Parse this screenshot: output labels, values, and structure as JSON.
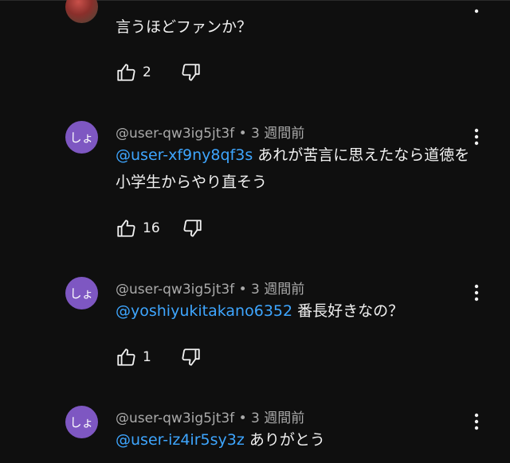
{
  "comments": [
    {
      "avatar_text": "",
      "author": "",
      "time": "",
      "mention": "",
      "text": "言うほどファンか？",
      "likes": "2"
    },
    {
      "avatar_text": "しょ",
      "author": "@user-qw3ig5jt3f",
      "time": "3 週間前",
      "mention": "@user-xf9ny8qf3s",
      "text": " あれが苦言に思えたなら道徳を小学生からやり直そう",
      "likes": "16"
    },
    {
      "avatar_text": "しょ",
      "author": "@user-qw3ig5jt3f",
      "time": "3 週間前",
      "mention": "@yoshiyukitakano6352",
      "text": " 番長好きなの？",
      "likes": "1"
    },
    {
      "avatar_text": "しょ",
      "author": "@user-qw3ig5jt3f",
      "time": "3 週間前",
      "mention": "@user-iz4ir5sy3z",
      "text": " ありがとう",
      "likes": ""
    }
  ],
  "colors": {
    "background": "#0f0f0f",
    "mention": "#3ea6ff",
    "avatar": "#7e57c2",
    "meta": "#aaaaaa"
  },
  "icons": {
    "like": "thumbs-up-icon",
    "dislike": "thumbs-down-icon",
    "menu": "vertical-ellipsis-icon"
  }
}
